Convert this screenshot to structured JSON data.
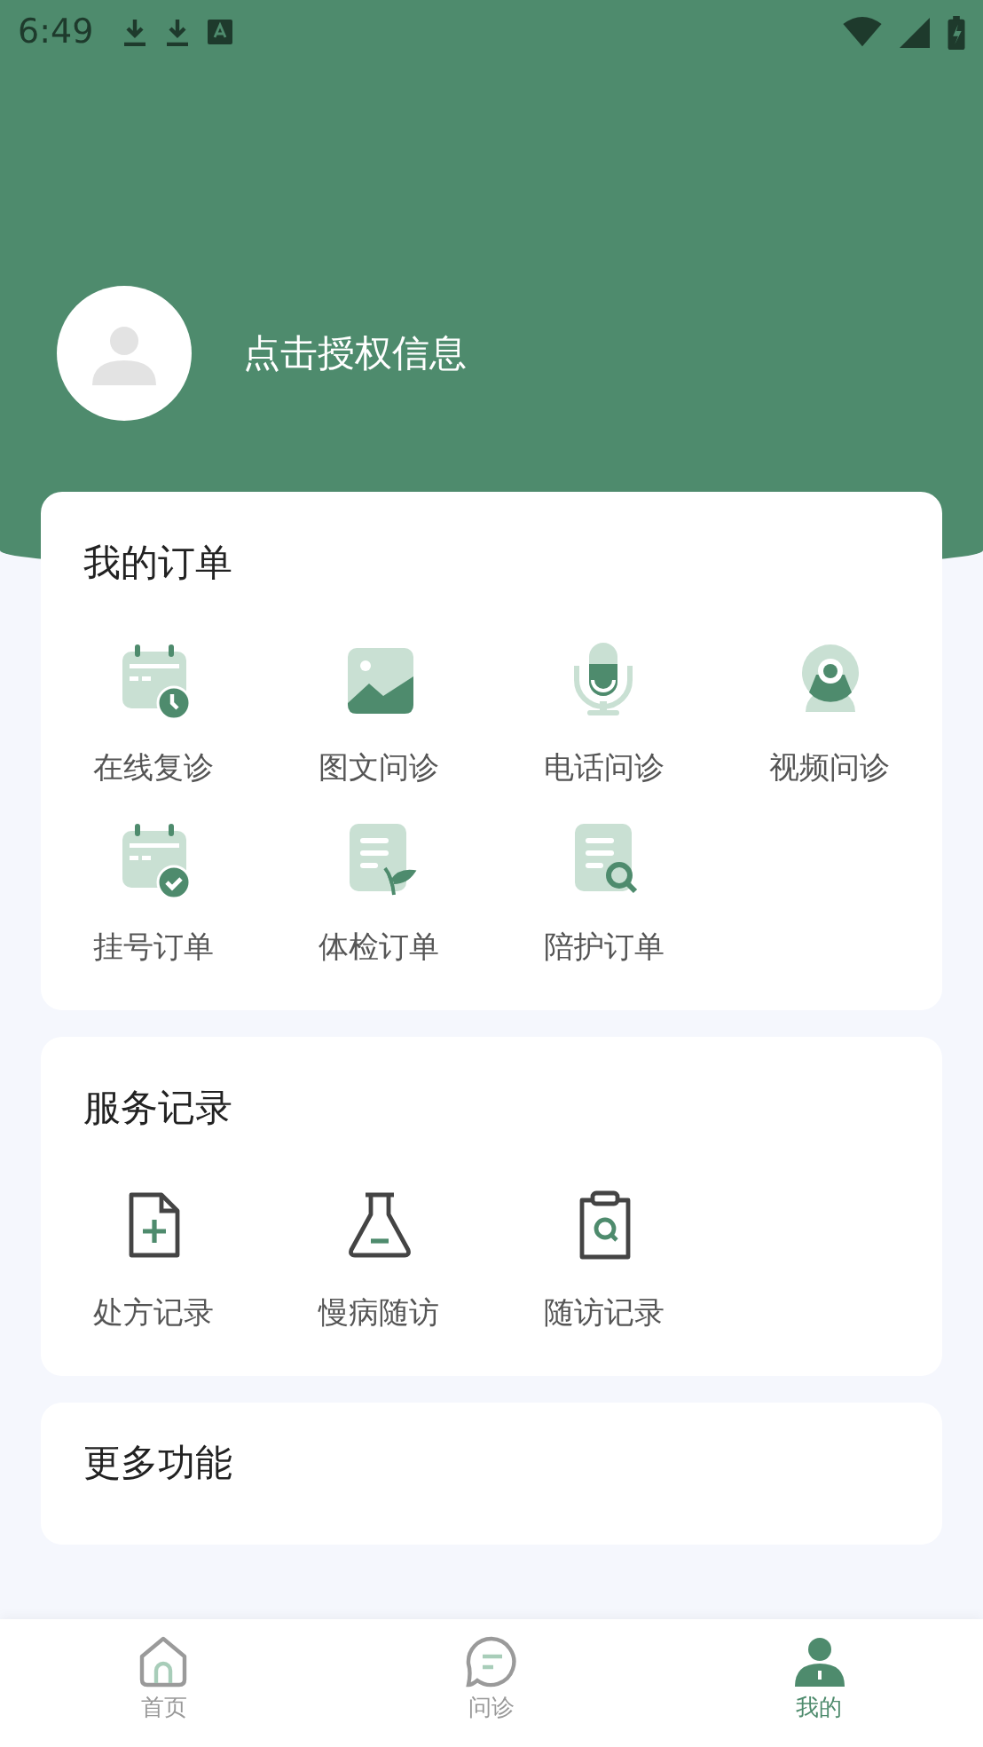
{
  "status_bar": {
    "time": "6:49"
  },
  "profile": {
    "name": "点击授权信息"
  },
  "orders": {
    "title": "我的订单",
    "items": [
      {
        "kind": "calendar-clock",
        "label": "在线复诊"
      },
      {
        "kind": "image",
        "label": "图文问诊"
      },
      {
        "kind": "microphone",
        "label": "电话问诊"
      },
      {
        "kind": "webcam",
        "label": "视频问诊"
      },
      {
        "kind": "calendar-check",
        "label": "挂号订单"
      },
      {
        "kind": "document-plant",
        "label": "体检订单"
      },
      {
        "kind": "document-search",
        "label": "陪护订单"
      }
    ]
  },
  "records": {
    "title": "服务记录",
    "items": [
      {
        "kind": "file-plus",
        "label": "处方记录"
      },
      {
        "kind": "flask",
        "label": "慢病随访"
      },
      {
        "kind": "clipboard-search",
        "label": "随访记录"
      }
    ]
  },
  "more": {
    "title": "更多功能"
  },
  "tabs": [
    {
      "kind": "home",
      "label": "首页",
      "selected": false
    },
    {
      "kind": "chat",
      "label": "问诊",
      "selected": false
    },
    {
      "kind": "person",
      "label": "我的",
      "selected": true
    }
  ]
}
